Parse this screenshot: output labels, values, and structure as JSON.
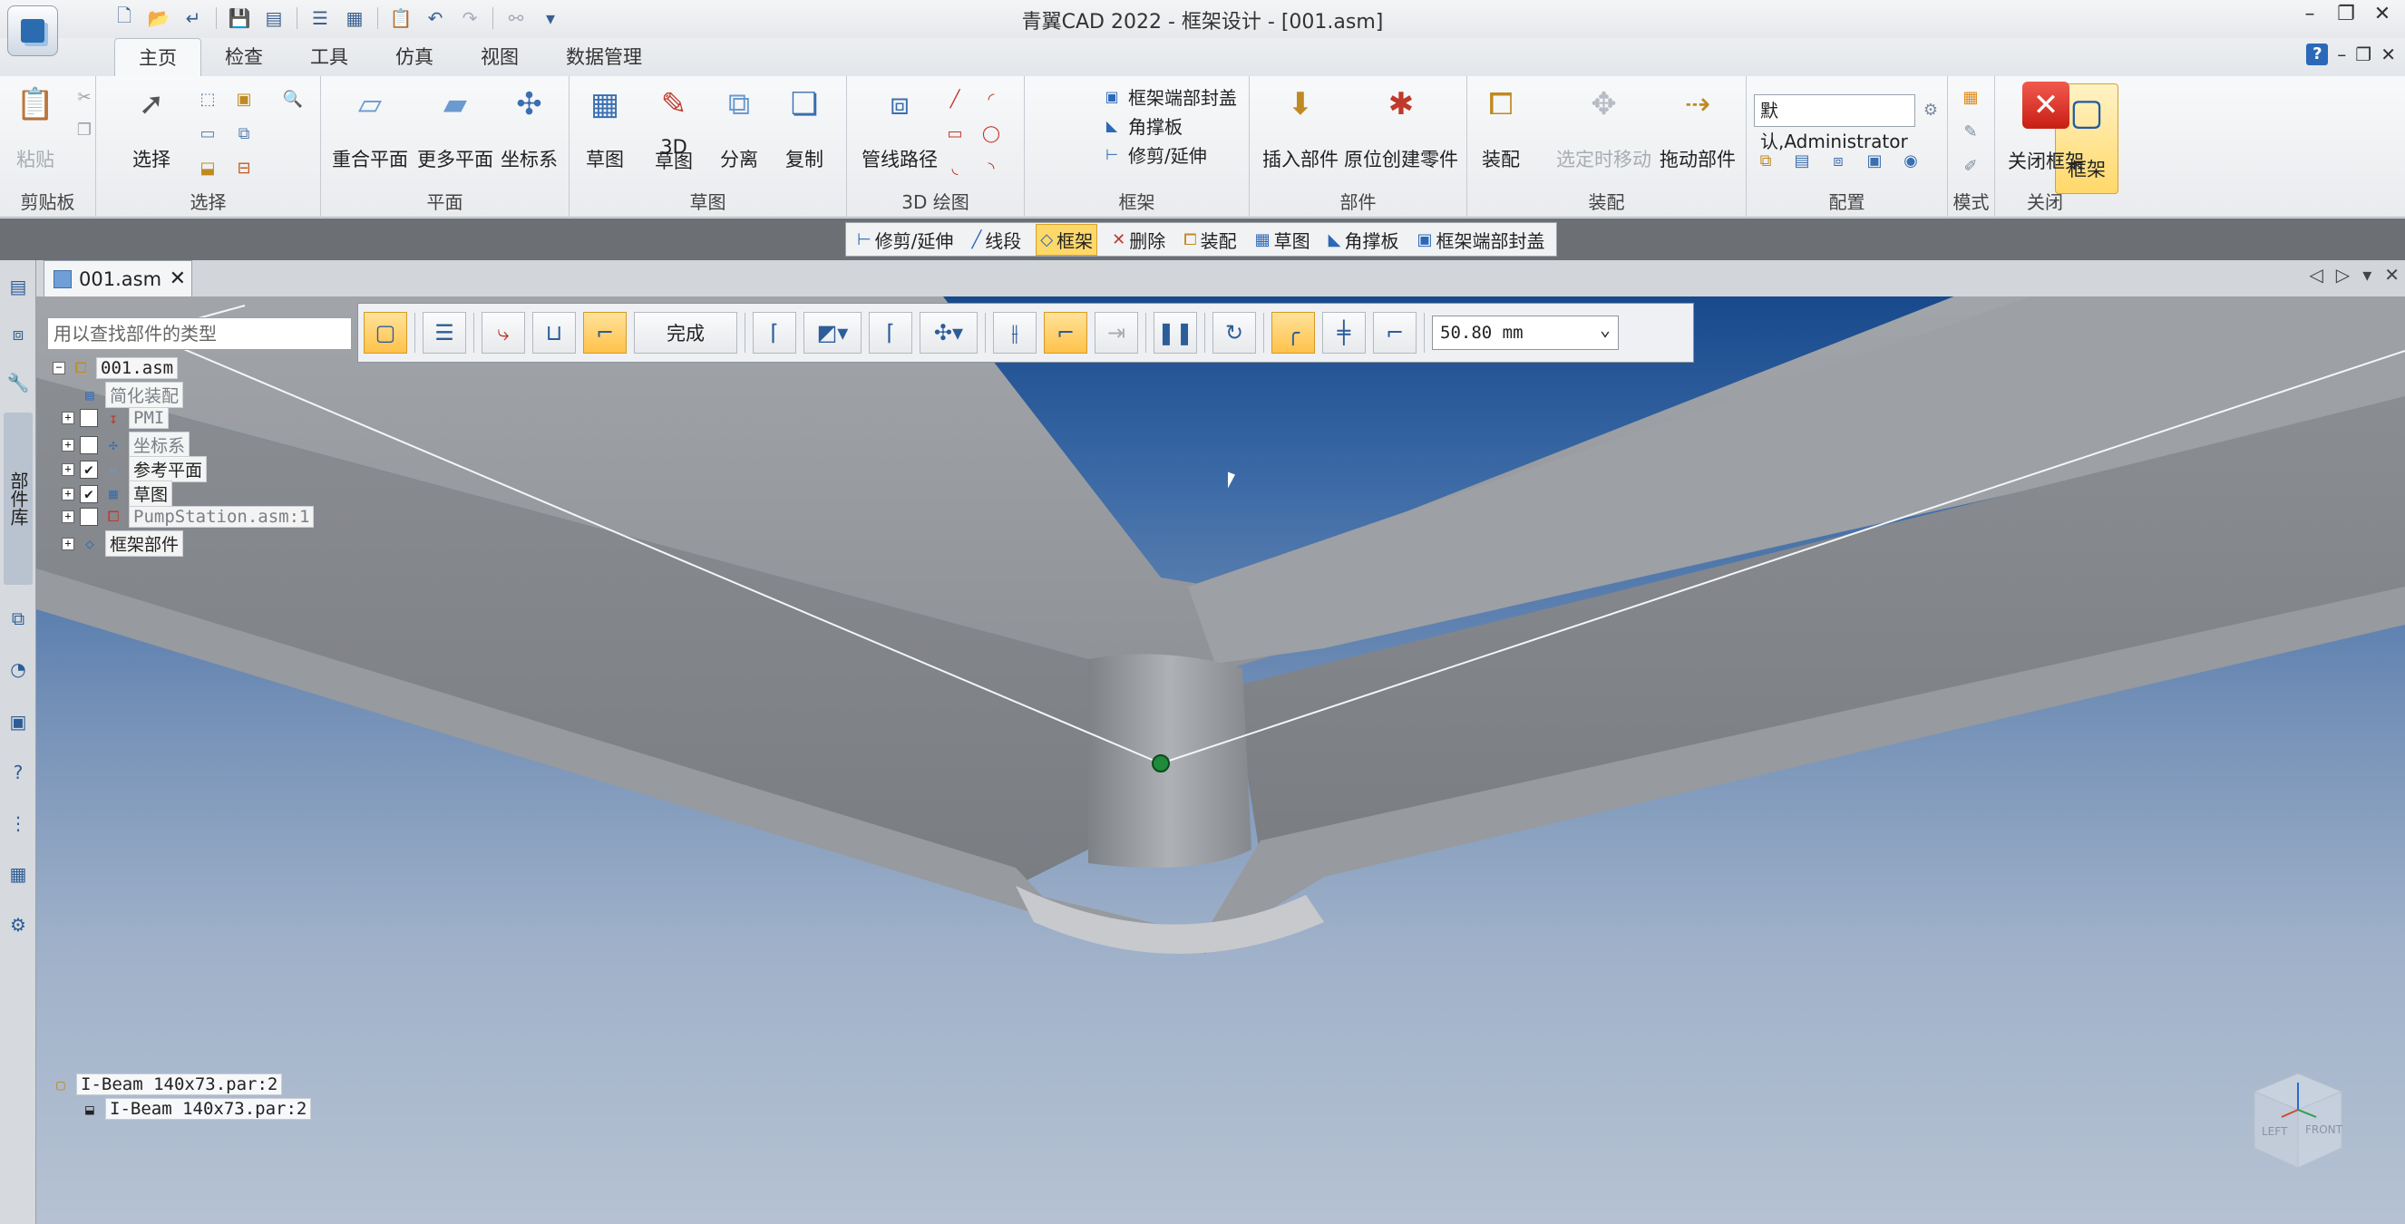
{
  "window": {
    "title": "青翼CAD 2022 - 框架设计 - [001.asm]"
  },
  "ribbon_tabs": [
    "主页",
    "检查",
    "工具",
    "仿真",
    "视图",
    "数据管理"
  ],
  "ribbon": {
    "clipboard": {
      "paste": "粘贴",
      "group": "剪贴板"
    },
    "select": {
      "select": "选择",
      "group": "选择"
    },
    "plane": {
      "coincident": "重合平面",
      "more": "更多平面",
      "coord": "坐标系",
      "group": "平面"
    },
    "sketch": {
      "sketch": "草图",
      "sketch3d_top": "3D",
      "sketch3d": "草图",
      "separate": "分离",
      "copy": "复制",
      "group": "草图"
    },
    "draw3d": {
      "pipe": "管线路径",
      "group": "3D 绘图"
    },
    "frame": {
      "frame": "框架",
      "endcap": "框架端部封盖",
      "gusset": "角撑板",
      "trim": "修剪/延伸",
      "group": "框架"
    },
    "part": {
      "insert": "插入部件",
      "create_in_place": "原位创建零件",
      "group": "部件"
    },
    "assemble": {
      "assemble": "装配",
      "move_selected": "选定时移动",
      "drag": "拖动部件",
      "group": "装配"
    },
    "config": {
      "user": "默认,Administrator",
      "group": "配置"
    },
    "mode": {
      "group": "模式"
    },
    "close": {
      "close_frame": "关闭框架",
      "group": "关闭"
    }
  },
  "command_bar": [
    "修剪/延伸",
    "线段",
    "框架",
    "删除",
    "装配",
    "草图",
    "角撑板",
    "框架端部封盖"
  ],
  "doc_tab": {
    "name": "001.asm"
  },
  "frame_bar": {
    "finish": "完成",
    "distance": "50.80 mm"
  },
  "pathfinder": {
    "search_placeholder": "用以查找部件的类型",
    "nodes": [
      "001.asm",
      "简化装配",
      "PMI",
      "坐标系",
      "参考平面",
      "草图",
      "PumpStation.asm:1",
      "框架部件"
    ],
    "bottom": [
      "I-Beam 140x73.par:2",
      "I-Beam 140x73.par:2"
    ]
  },
  "left_toolbar": {
    "vertical_tab": "部件库"
  },
  "view_cube": {
    "left": "LEFT",
    "front": "FRONT"
  }
}
